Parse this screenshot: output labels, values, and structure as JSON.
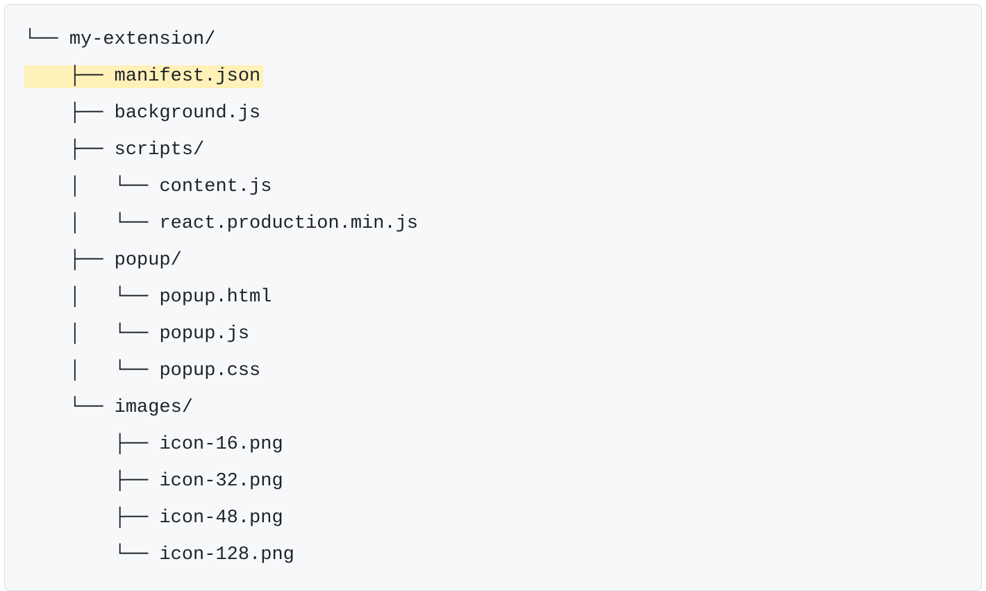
{
  "tree": {
    "lines": [
      {
        "prefix": "└── ",
        "name": "my-extension/",
        "highlight": false
      },
      {
        "prefix": "    ├── ",
        "name": "manifest.json",
        "highlight": true
      },
      {
        "prefix": "    ├── ",
        "name": "background.js",
        "highlight": false
      },
      {
        "prefix": "    ├── ",
        "name": "scripts/",
        "highlight": false
      },
      {
        "prefix": "    │   └── ",
        "name": "content.js",
        "highlight": false
      },
      {
        "prefix": "    │   └── ",
        "name": "react.production.min.js",
        "highlight": false
      },
      {
        "prefix": "    ├── ",
        "name": "popup/",
        "highlight": false
      },
      {
        "prefix": "    │   └── ",
        "name": "popup.html",
        "highlight": false
      },
      {
        "prefix": "    │   └── ",
        "name": "popup.js",
        "highlight": false
      },
      {
        "prefix": "    │   └── ",
        "name": "popup.css",
        "highlight": false
      },
      {
        "prefix": "    └── ",
        "name": "images/",
        "highlight": false
      },
      {
        "prefix": "        ├── ",
        "name": "icon-16.png",
        "highlight": false
      },
      {
        "prefix": "        ├── ",
        "name": "icon-32.png",
        "highlight": false
      },
      {
        "prefix": "        ├── ",
        "name": "icon-48.png",
        "highlight": false
      },
      {
        "prefix": "        └── ",
        "name": "icon-128.png",
        "highlight": false
      }
    ]
  }
}
